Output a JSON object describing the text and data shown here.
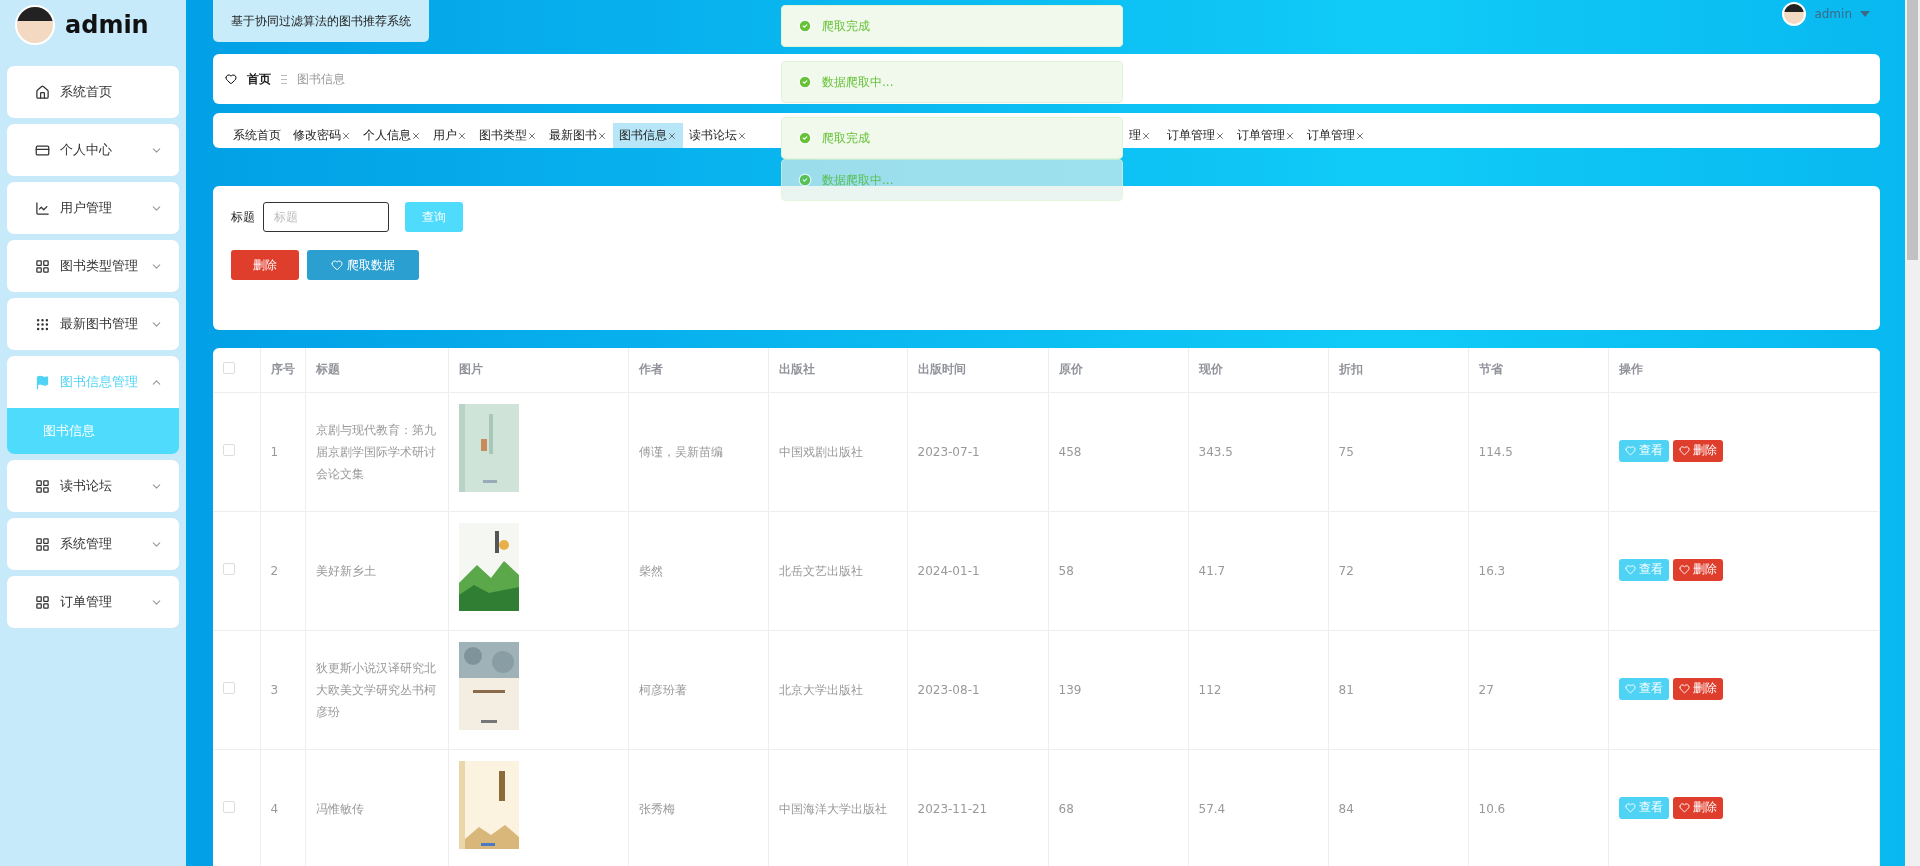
{
  "sidebar": {
    "user": "admin",
    "items": [
      {
        "kind": "link",
        "label": "系统首页"
      },
      {
        "kind": "menu",
        "label": "个人中心",
        "expanded": false
      },
      {
        "kind": "menu",
        "label": "用户管理",
        "expanded": false
      },
      {
        "kind": "menu",
        "label": "图书类型管理",
        "expanded": false
      },
      {
        "kind": "menu",
        "label": "最新图书管理",
        "expanded": false
      },
      {
        "kind": "menu",
        "label": "图书信息管理",
        "expanded": true,
        "children": [
          {
            "label": "图书信息",
            "selected": true
          }
        ]
      },
      {
        "kind": "menu",
        "label": "读书论坛",
        "expanded": false
      },
      {
        "kind": "menu",
        "label": "系统管理",
        "expanded": false
      },
      {
        "kind": "menu",
        "label": "订单管理",
        "expanded": false
      }
    ]
  },
  "header": {
    "system_title": "基于协同过滤算法的图书推荐系统",
    "user": "admin"
  },
  "breadcrumb": [
    "首页",
    "图书信息"
  ],
  "tabs": [
    {
      "label": "系统首页",
      "closable": false,
      "selected": false,
      "partly_hidden": false
    },
    {
      "label": "修改密码",
      "closable": true,
      "selected": false,
      "partly_hidden": false
    },
    {
      "label": "个人信息",
      "closable": true,
      "selected": false,
      "partly_hidden": false
    },
    {
      "label": "用户",
      "closable": true,
      "selected": false,
      "partly_hidden": false
    },
    {
      "label": "图书类型",
      "closable": true,
      "selected": false,
      "partly_hidden": false
    },
    {
      "label": "最新图书",
      "closable": true,
      "selected": false,
      "partly_hidden": false
    },
    {
      "label": "图书信息",
      "closable": true,
      "selected": true,
      "partly_hidden": false
    },
    {
      "label": "读书论坛",
      "closable": true,
      "selected": false,
      "partly_hidden": false
    },
    {
      "label": "理",
      "closable": true,
      "selected": false,
      "partly_hidden": true
    },
    {
      "label": "订单管理",
      "closable": true,
      "selected": false,
      "partly_hidden": false
    },
    {
      "label": "订单管理",
      "closable": true,
      "selected": false,
      "partly_hidden": false
    },
    {
      "label": "订单管理",
      "closable": true,
      "selected": false,
      "partly_hidden": false
    }
  ],
  "toasts": [
    {
      "text": "爬取完成",
      "fading": false
    },
    {
      "text": "数据爬取中...",
      "fading": false
    },
    {
      "text": "爬取完成",
      "fading": false
    },
    {
      "text": "数据爬取中...",
      "fading": true
    }
  ],
  "search": {
    "label": "标题",
    "placeholder": "标题",
    "button": "查询"
  },
  "actions": [
    {
      "kind": "danger",
      "label": "删除"
    },
    {
      "kind": "primary",
      "label": "爬取数据"
    }
  ],
  "table": {
    "all_checked": false,
    "columns": [
      "序号",
      "标题",
      "图片",
      "作者",
      "出版社",
      "出版时间",
      "原价",
      "现价",
      "折扣",
      "节省",
      "操作"
    ],
    "rows": [
      {
        "checked": false,
        "index": "1",
        "title": "京剧与现代教育：第九届京剧学国际学术研讨会论文集",
        "author": "傅谨，吴新苗编",
        "publisher": "中国戏剧出版社",
        "date": "2023-07-1",
        "price": "458",
        "current_price": "343.5",
        "discount": "75",
        "saved": "114.5",
        "buttons": [
          {
            "kind": "view",
            "label": "查看"
          },
          {
            "kind": "delete",
            "label": "删除"
          }
        ]
      },
      {
        "checked": false,
        "index": "2",
        "title": "美好新乡土",
        "author": "柴然",
        "publisher": "北岳文艺出版社",
        "date": "2024-01-1",
        "price": "58",
        "current_price": "41.7",
        "discount": "72",
        "saved": "16.3",
        "buttons": [
          {
            "kind": "view",
            "label": "查看"
          },
          {
            "kind": "delete",
            "label": "删除"
          }
        ]
      },
      {
        "checked": false,
        "index": "3",
        "title": "狄更斯小说汉译研究北大欧美文学研究丛书柯彦玢",
        "author": "柯彦玢著",
        "publisher": "北京大学出版社",
        "date": "2023-08-1",
        "price": "139",
        "current_price": "112",
        "discount": "81",
        "saved": "27",
        "buttons": [
          {
            "kind": "view",
            "label": "查看"
          },
          {
            "kind": "delete",
            "label": "删除"
          }
        ]
      },
      {
        "checked": false,
        "index": "4",
        "title": "冯惟敏传",
        "author": "张秀梅",
        "publisher": "中国海洋大学出版社",
        "date": "2023-11-21",
        "price": "68",
        "current_price": "57.4",
        "discount": "84",
        "saved": "10.6",
        "buttons": [
          {
            "kind": "view",
            "label": "查看"
          },
          {
            "kind": "delete",
            "label": "删除"
          }
        ]
      }
    ]
  }
}
